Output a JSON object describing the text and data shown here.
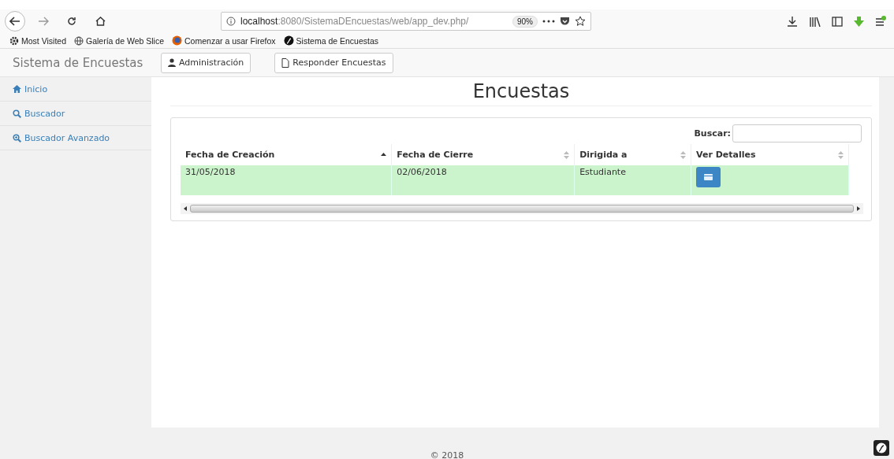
{
  "browser": {
    "url_host": "localhost",
    "url_path": ":8080/SistemaDEncuestas/web/app_dev.php/",
    "zoom": "90%",
    "bookmarks": [
      {
        "label": "Most Visited",
        "kind": "gear"
      },
      {
        "label": "Galería de Web Slice",
        "kind": "globe"
      },
      {
        "label": "Comenzar a usar Firefox",
        "kind": "firefox"
      },
      {
        "label": "Sistema de Encuestas",
        "kind": "sf"
      }
    ]
  },
  "navbar": {
    "brand": "Sistema de Encuestas",
    "buttons": [
      {
        "label": "Administración",
        "kind": "user"
      },
      {
        "label": "Responder Encuestas",
        "kind": "file"
      }
    ]
  },
  "sidebar": {
    "items": [
      {
        "label": "Inicio",
        "kind": "home"
      },
      {
        "label": "Buscador",
        "kind": "search"
      },
      {
        "label": "Buscador Avanzado",
        "kind": "zoom"
      }
    ]
  },
  "page_title": "Encuestas",
  "table": {
    "search_label": "Buscar:",
    "columns": [
      {
        "label": "Fecha de Creación",
        "sorted": true
      },
      {
        "label": "Fecha de Cierre",
        "sorted": false
      },
      {
        "label": "Dirigida a",
        "sorted": false
      },
      {
        "label": "Ver Detalles",
        "sorted": false
      }
    ],
    "rows": [
      {
        "selected": true,
        "cells": [
          "31/05/2018",
          "02/06/2018",
          "Estudiante"
        ]
      }
    ]
  },
  "footer": "© 2018"
}
